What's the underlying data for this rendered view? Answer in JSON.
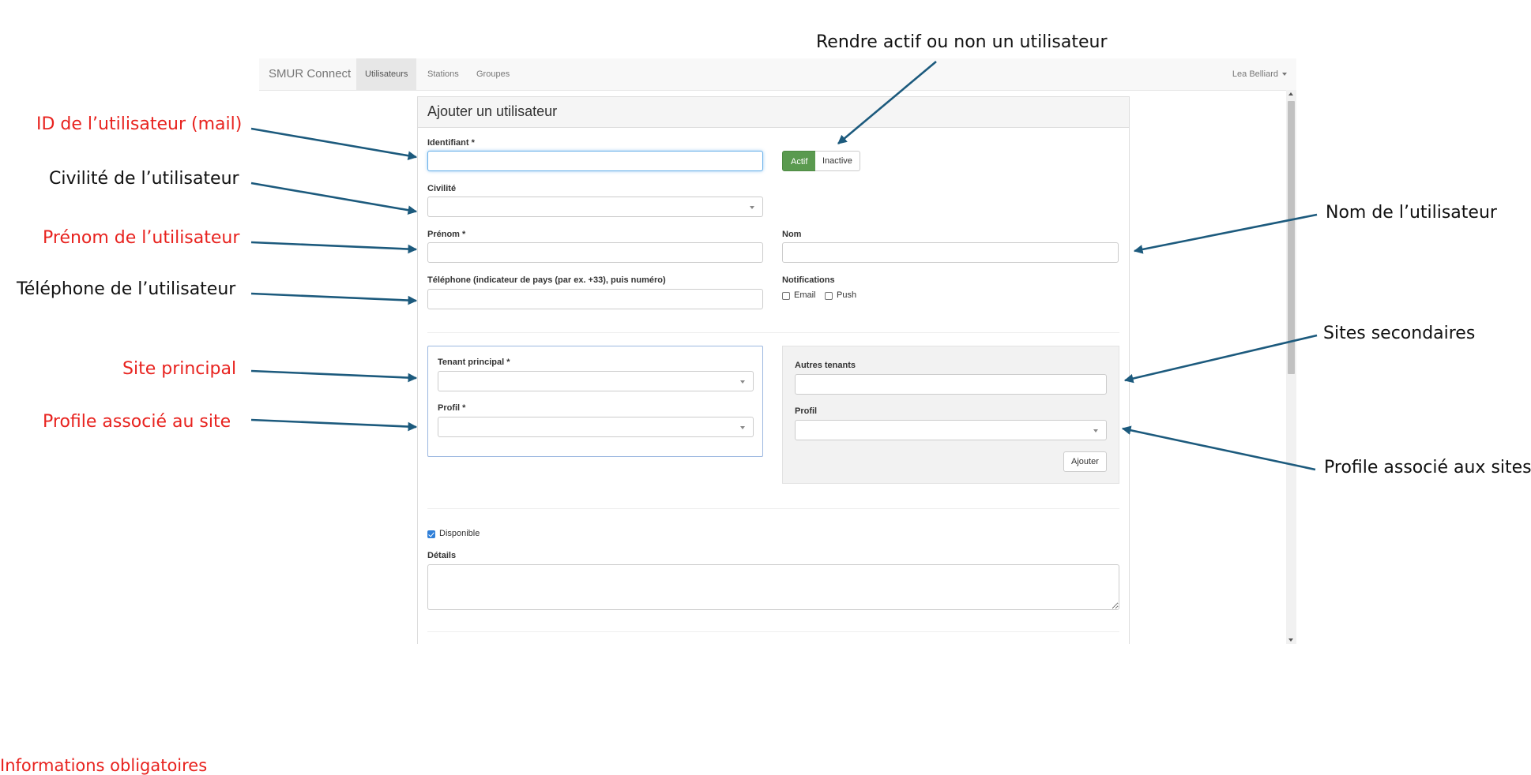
{
  "annotations": {
    "left": [
      {
        "text": "ID de l’utilisateur (mail)",
        "required": true
      },
      {
        "text": "Civilité de l’utilisateur",
        "required": false
      },
      {
        "text": "Prénom de l’utilisateur",
        "required": true
      },
      {
        "text": "Téléphone de l’utilisateur",
        "required": false
      },
      {
        "text": "Site principal",
        "required": true
      },
      {
        "text": "Profile associé au site",
        "required": true
      }
    ],
    "top": "Rendre actif ou non un utilisateur",
    "right": [
      "Nom de l’utilisateur",
      "Sites secondaires",
      "Profile associé aux sites"
    ],
    "legend": "Informations obligatoires"
  },
  "colors": {
    "required_text": "#e8231f",
    "arrow": "#1c5a7d",
    "active_button": "#5a9a4f"
  },
  "navbar": {
    "brand": "SMUR Connect",
    "tabs": [
      {
        "label": "Utilisateurs",
        "active": true
      },
      {
        "label": "Stations",
        "active": false
      },
      {
        "label": "Groupes",
        "active": false
      }
    ],
    "user": "Lea Belliard"
  },
  "form": {
    "title": "Ajouter un utilisateur",
    "identifiant_label": "Identifiant *",
    "identifiant_value": "",
    "status": {
      "active_label": "Actif",
      "inactive_label": "Inactive",
      "selected": "Actif"
    },
    "civilite_label": "Civilité",
    "prenom_label": "Prénom *",
    "nom_label": "Nom",
    "telephone_label": "Téléphone (indicateur de pays (par ex. +33), puis numéro)",
    "notifications": {
      "label": "Notifications",
      "email_label": "Email",
      "email_checked": false,
      "push_label": "Push",
      "push_checked": false
    },
    "primary_tenant": {
      "tenant_label": "Tenant principal *",
      "profile_label": "Profil *"
    },
    "other_tenants": {
      "tenants_label": "Autres tenants",
      "profile_label": "Profil",
      "add_button": "Ajouter"
    },
    "disponible": {
      "label": "Disponible",
      "checked": true
    },
    "details_label": "Détails"
  }
}
